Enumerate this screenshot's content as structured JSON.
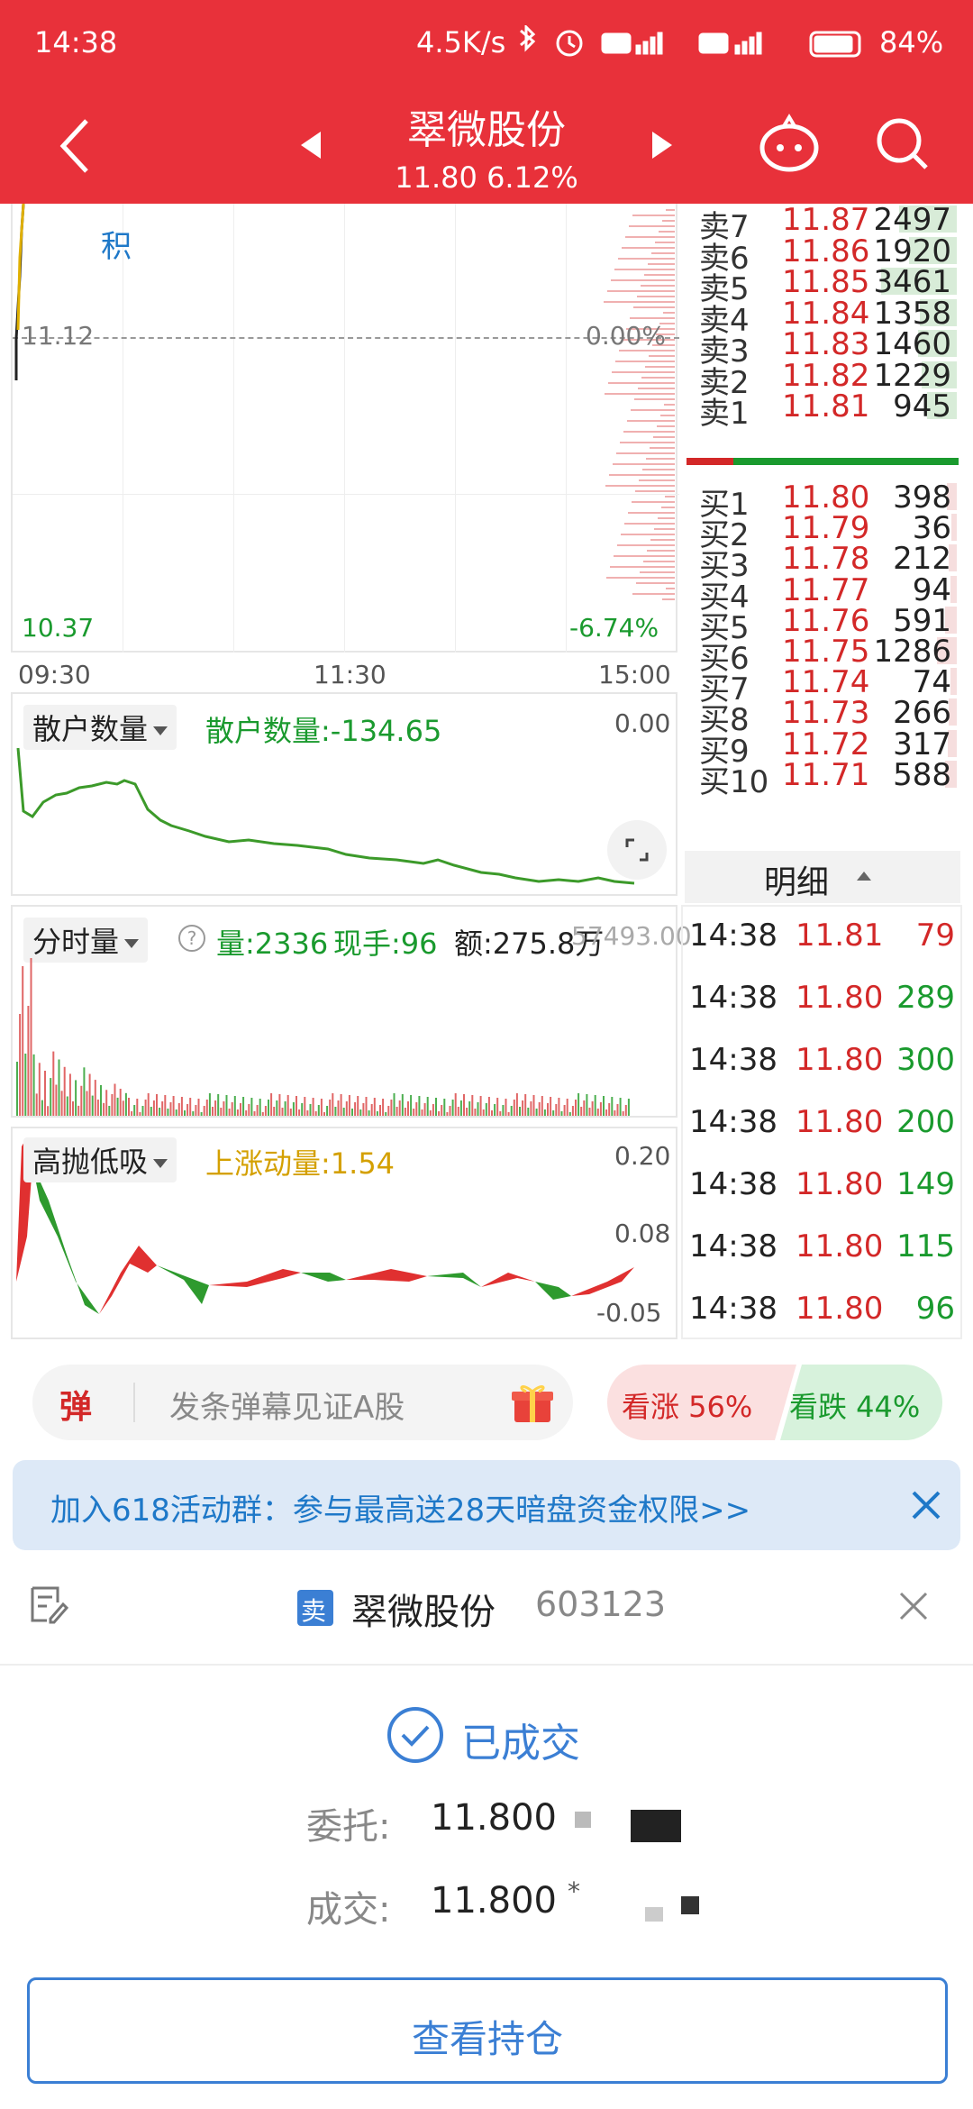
{
  "status": {
    "time": "14:38",
    "net_speed": "4.5K/s",
    "battery": "84%"
  },
  "header": {
    "title": "翠微股份",
    "price_change": "11.80 6.12%"
  },
  "main_chart": {
    "label_ji": "积",
    "ref_price": "11.12",
    "ref_pct": "0.00%",
    "low_price": "10.37",
    "low_pct": "-6.74%",
    "time_start": "09:30",
    "time_mid": "11:30",
    "time_end": "15:00"
  },
  "order_book": {
    "asks": [
      {
        "label": "卖7",
        "price": "11.87",
        "volume": "2497",
        "depth": 0.72
      },
      {
        "label": "卖6",
        "price": "11.86",
        "volume": "1920",
        "depth": 0.55
      },
      {
        "label": "卖5",
        "price": "11.85",
        "volume": "3461",
        "depth": 1.0
      },
      {
        "label": "卖4",
        "price": "11.84",
        "volume": "1358",
        "depth": 0.39
      },
      {
        "label": "卖3",
        "price": "11.83",
        "volume": "1460",
        "depth": 0.42
      },
      {
        "label": "卖2",
        "price": "11.82",
        "volume": "1229",
        "depth": 0.35
      },
      {
        "label": "卖1",
        "price": "11.81",
        "volume": "945",
        "depth": 0.27
      }
    ],
    "bids": [
      {
        "label": "买1",
        "price": "11.80",
        "volume": "398",
        "depth": 0.31
      },
      {
        "label": "买2",
        "price": "11.79",
        "volume": "36",
        "depth": 0.03
      },
      {
        "label": "买3",
        "price": "11.78",
        "volume": "212",
        "depth": 0.16
      },
      {
        "label": "买4",
        "price": "11.77",
        "volume": "94",
        "depth": 0.07
      },
      {
        "label": "买5",
        "price": "11.76",
        "volume": "591",
        "depth": 0.46
      },
      {
        "label": "买6",
        "price": "11.75",
        "volume": "1286",
        "depth": 1.0
      },
      {
        "label": "买7",
        "price": "11.74",
        "volume": "74",
        "depth": 0.06
      },
      {
        "label": "买8",
        "price": "11.73",
        "volume": "266",
        "depth": 0.21
      },
      {
        "label": "买9",
        "price": "11.72",
        "volume": "317",
        "depth": 0.25
      },
      {
        "label": "买10",
        "price": "11.71",
        "volume": "588",
        "depth": 0.46
      }
    ]
  },
  "retail_panel": {
    "dropdown_label": "散户数量",
    "value_text": "散户数量:-134.65",
    "axis_top": "0.00"
  },
  "volume_panel": {
    "dropdown_label": "分时量",
    "qty": "量:2336",
    "hand": "现手:96",
    "amount": "额:275.8万",
    "axis_top": "57493.00"
  },
  "momentum_panel": {
    "dropdown_label": "高抛低吸",
    "value_text": "上涨动量:1.54",
    "axis_top": "0.20",
    "axis_mid": "0.08",
    "axis_low": "-0.05"
  },
  "trades": {
    "header": "明细",
    "rows": [
      {
        "time": "14:38",
        "price": "11.81",
        "volume": "79",
        "color": "#d32828"
      },
      {
        "time": "14:38",
        "price": "11.80",
        "volume": "289",
        "color": "#1a9a2e"
      },
      {
        "time": "14:38",
        "price": "11.80",
        "volume": "300",
        "color": "#1a9a2e"
      },
      {
        "time": "14:38",
        "price": "11.80",
        "volume": "200",
        "color": "#1a9a2e"
      },
      {
        "time": "14:38",
        "price": "11.80",
        "volume": "149",
        "color": "#1a9a2e"
      },
      {
        "time": "14:38",
        "price": "11.80",
        "volume": "115",
        "color": "#1a9a2e"
      },
      {
        "time": "14:38",
        "price": "11.80",
        "volume": "96",
        "color": "#1a9a2e"
      }
    ]
  },
  "danmu": {
    "icon_text": "弹",
    "placeholder": "发条弹幕见证A股",
    "rise_label": "看涨 56%",
    "fall_label": "看跌 44%",
    "rise_fraction": 0.56
  },
  "banner": {
    "text": "加入618活动群：参与最高送28天暗盘资金权限>>"
  },
  "order_sheet": {
    "badge": "卖",
    "stock_name": "翠微股份",
    "stock_code": "603123",
    "status": "已成交",
    "order_label": "委托:",
    "order_price": "11.800",
    "deal_label": "成交:",
    "deal_price": "11.800",
    "deal_mark": "*",
    "button_label": "查看持仓"
  },
  "colors": {
    "brand_red": "#e8313a",
    "up_red": "#d32828",
    "down_green": "#1a9a2e",
    "link_blue": "#1e78c8"
  }
}
